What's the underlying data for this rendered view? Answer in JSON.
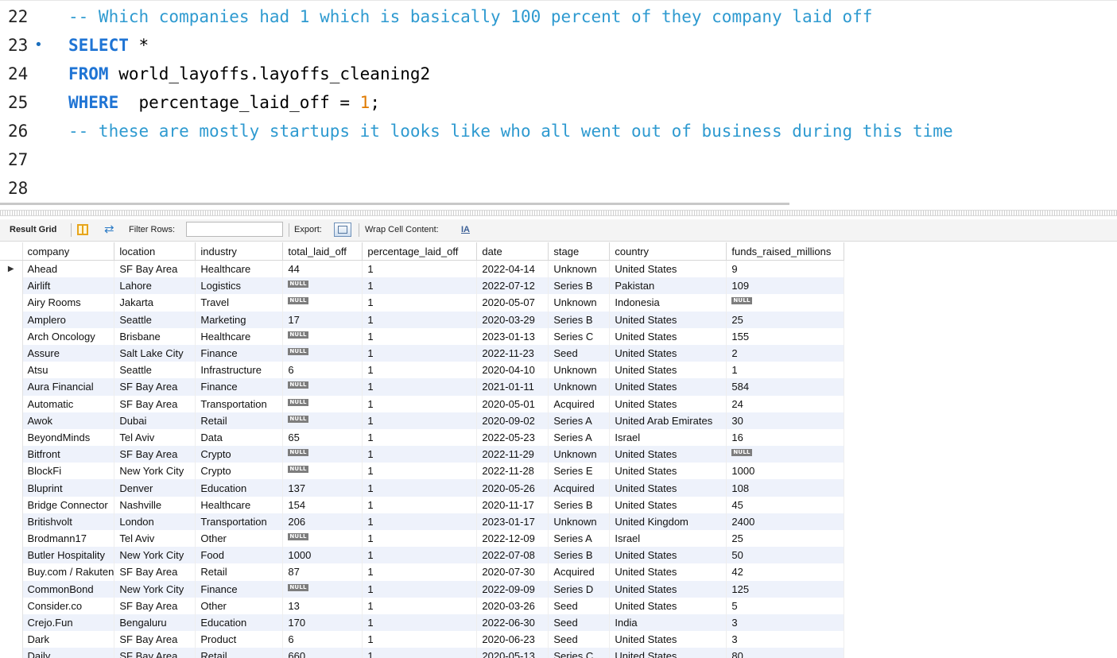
{
  "editor": {
    "lines": [
      {
        "num": "22",
        "marker": "",
        "parts": [
          {
            "t": "-- Which companies had 1 which is basically 100 percent of they company laid off",
            "c": "cmt"
          }
        ]
      },
      {
        "num": "23",
        "marker": "•",
        "parts": [
          {
            "t": "SELECT",
            "c": "kw"
          },
          {
            "t": " *",
            "c": ""
          }
        ]
      },
      {
        "num": "24",
        "marker": "",
        "parts": [
          {
            "t": "FROM",
            "c": "kw"
          },
          {
            "t": " world_layoffs.layoffs_cleaning2",
            "c": ""
          }
        ]
      },
      {
        "num": "25",
        "marker": "",
        "parts": [
          {
            "t": "WHERE",
            "c": "kw"
          },
          {
            "t": "  percentage_laid_off = ",
            "c": ""
          },
          {
            "t": "1",
            "c": "num"
          },
          {
            "t": ";",
            "c": ""
          }
        ]
      },
      {
        "num": "26",
        "marker": "",
        "parts": [
          {
            "t": "-- these are mostly startups it looks like who all went out of business during this time",
            "c": "cmt"
          }
        ]
      },
      {
        "num": "27",
        "marker": "",
        "parts": []
      },
      {
        "num": "28",
        "marker": "",
        "parts": []
      }
    ]
  },
  "toolbar": {
    "result_grid": "Result Grid",
    "filter_rows": "Filter Rows:",
    "export": "Export:",
    "wrap_cell": "Wrap Cell Content:",
    "wrap_icon_text": "IA"
  },
  "grid": {
    "null_label": "NULL",
    "current_row_marker": "▶",
    "columns": [
      "company",
      "location",
      "industry",
      "total_laid_off",
      "percentage_laid_off",
      "date",
      "stage",
      "country",
      "funds_raised_millions"
    ],
    "rows": [
      [
        "Ahead",
        "SF Bay Area",
        "Healthcare",
        "44",
        "1",
        "2022-04-14",
        "Unknown",
        "United States",
        "9"
      ],
      [
        "Airlift",
        "Lahore",
        "Logistics",
        null,
        "1",
        "2022-07-12",
        "Series B",
        "Pakistan",
        "109"
      ],
      [
        "Airy Rooms",
        "Jakarta",
        "Travel",
        null,
        "1",
        "2020-05-07",
        "Unknown",
        "Indonesia",
        null
      ],
      [
        "Amplero",
        "Seattle",
        "Marketing",
        "17",
        "1",
        "2020-03-29",
        "Series B",
        "United States",
        "25"
      ],
      [
        "Arch Oncology",
        "Brisbane",
        "Healthcare",
        null,
        "1",
        "2023-01-13",
        "Series C",
        "United States",
        "155"
      ],
      [
        "Assure",
        "Salt Lake City",
        "Finance",
        null,
        "1",
        "2022-11-23",
        "Seed",
        "United States",
        "2"
      ],
      [
        "Atsu",
        "Seattle",
        "Infrastructure",
        "6",
        "1",
        "2020-04-10",
        "Unknown",
        "United States",
        "1"
      ],
      [
        "Aura Financial",
        "SF Bay Area",
        "Finance",
        null,
        "1",
        "2021-01-11",
        "Unknown",
        "United States",
        "584"
      ],
      [
        "Automatic",
        "SF Bay Area",
        "Transportation",
        null,
        "1",
        "2020-05-01",
        "Acquired",
        "United States",
        "24"
      ],
      [
        "Awok",
        "Dubai",
        "Retail",
        null,
        "1",
        "2020-09-02",
        "Series A",
        "United Arab Emirates",
        "30"
      ],
      [
        "BeyondMinds",
        "Tel Aviv",
        "Data",
        "65",
        "1",
        "2022-05-23",
        "Series A",
        "Israel",
        "16"
      ],
      [
        "Bitfront",
        "SF Bay Area",
        "Crypto",
        null,
        "1",
        "2022-11-29",
        "Unknown",
        "United States",
        null
      ],
      [
        "BlockFi",
        "New York City",
        "Crypto",
        null,
        "1",
        "2022-11-28",
        "Series E",
        "United States",
        "1000"
      ],
      [
        "Bluprint",
        "Denver",
        "Education",
        "137",
        "1",
        "2020-05-26",
        "Acquired",
        "United States",
        "108"
      ],
      [
        "Bridge Connector",
        "Nashville",
        "Healthcare",
        "154",
        "1",
        "2020-11-17",
        "Series B",
        "United States",
        "45"
      ],
      [
        "Britishvolt",
        "London",
        "Transportation",
        "206",
        "1",
        "2023-01-17",
        "Unknown",
        "United Kingdom",
        "2400"
      ],
      [
        "Brodmann17",
        "Tel Aviv",
        "Other",
        null,
        "1",
        "2022-12-09",
        "Series A",
        "Israel",
        "25"
      ],
      [
        "Butler Hospitality",
        "New York City",
        "Food",
        "1000",
        "1",
        "2022-07-08",
        "Series B",
        "United States",
        "50"
      ],
      [
        "Buy.com / Rakuten",
        "SF Bay Area",
        "Retail",
        "87",
        "1",
        "2020-07-30",
        "Acquired",
        "United States",
        "42"
      ],
      [
        "CommonBond",
        "New York City",
        "Finance",
        null,
        "1",
        "2022-09-09",
        "Series D",
        "United States",
        "125"
      ],
      [
        "Consider.co",
        "SF Bay Area",
        "Other",
        "13",
        "1",
        "2020-03-26",
        "Seed",
        "United States",
        "5"
      ],
      [
        "Crejo.Fun",
        "Bengaluru",
        "Education",
        "170",
        "1",
        "2022-06-30",
        "Seed",
        "India",
        "3"
      ],
      [
        "Dark",
        "SF Bay Area",
        "Product",
        "6",
        "1",
        "2020-06-23",
        "Seed",
        "United States",
        "3"
      ],
      [
        "Daily",
        "SF Bay Area",
        "Retail",
        "660",
        "1",
        "2020-05-13",
        "Series C",
        "United States",
        "80"
      ]
    ]
  }
}
